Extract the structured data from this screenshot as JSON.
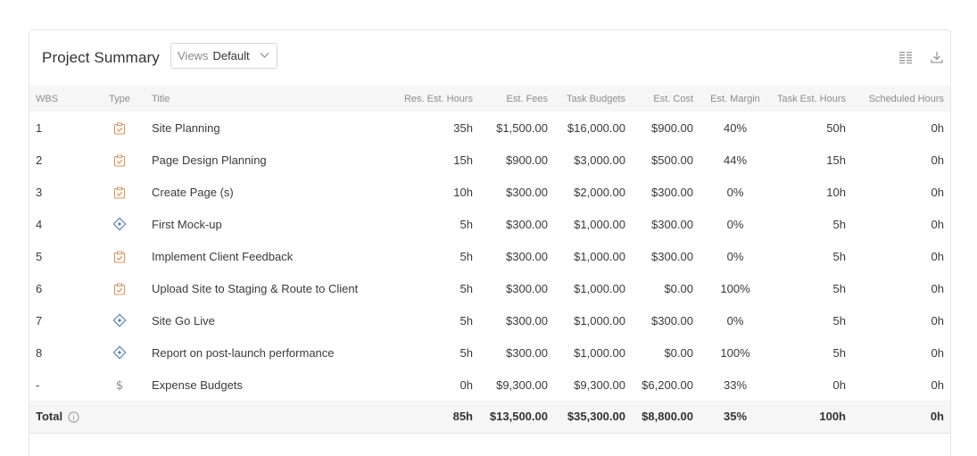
{
  "header": {
    "title": "Project Summary",
    "views_label": "Views",
    "views_value": "Default"
  },
  "columns": {
    "wbs": "WBS",
    "type": "Type",
    "title": "Title",
    "res_est_hours": "Res. Est. Hours",
    "est_fees": "Est. Fees",
    "task_budgets": "Task Budgets",
    "est_cost": "Est. Cost",
    "est_margin": "Est. Margin",
    "task_est_hours": "Task Est. Hours",
    "scheduled_hours": "Scheduled Hours"
  },
  "rows": [
    {
      "wbs": "1",
      "type": "task-icon",
      "title": "Site Planning",
      "res_est_hours": "35h",
      "est_fees": "$1,500.00",
      "task_budgets": "$16,000.00",
      "est_cost": "$900.00",
      "est_margin": "40%",
      "task_est_hours": "50h",
      "scheduled_hours": "0h"
    },
    {
      "wbs": "2",
      "type": "task-icon",
      "title": "Page Design Planning",
      "res_est_hours": "15h",
      "est_fees": "$900.00",
      "task_budgets": "$3,000.00",
      "est_cost": "$500.00",
      "est_margin": "44%",
      "task_est_hours": "15h",
      "scheduled_hours": "0h"
    },
    {
      "wbs": "3",
      "type": "task-icon",
      "title": "Create Page (s)",
      "res_est_hours": "10h",
      "est_fees": "$300.00",
      "task_budgets": "$2,000.00",
      "est_cost": "$300.00",
      "est_margin": "0%",
      "task_est_hours": "10h",
      "scheduled_hours": "0h"
    },
    {
      "wbs": "4",
      "type": "milestone-icon",
      "title": "First Mock-up",
      "res_est_hours": "5h",
      "est_fees": "$300.00",
      "task_budgets": "$1,000.00",
      "est_cost": "$300.00",
      "est_margin": "0%",
      "task_est_hours": "5h",
      "scheduled_hours": "0h"
    },
    {
      "wbs": "5",
      "type": "task-icon",
      "title": "Implement Client Feedback",
      "res_est_hours": "5h",
      "est_fees": "$300.00",
      "task_budgets": "$1,000.00",
      "est_cost": "$300.00",
      "est_margin": "0%",
      "task_est_hours": "5h",
      "scheduled_hours": "0h"
    },
    {
      "wbs": "6",
      "type": "task-icon",
      "title": "Upload Site to Staging & Route to Client",
      "res_est_hours": "5h",
      "est_fees": "$300.00",
      "task_budgets": "$1,000.00",
      "est_cost": "$0.00",
      "est_margin": "100%",
      "task_est_hours": "5h",
      "scheduled_hours": "0h"
    },
    {
      "wbs": "7",
      "type": "milestone-icon",
      "title": "Site Go Live",
      "res_est_hours": "5h",
      "est_fees": "$300.00",
      "task_budgets": "$1,000.00",
      "est_cost": "$300.00",
      "est_margin": "0%",
      "task_est_hours": "5h",
      "scheduled_hours": "0h"
    },
    {
      "wbs": "8",
      "type": "milestone-icon",
      "title": "Report on post-launch performance",
      "res_est_hours": "5h",
      "est_fees": "$300.00",
      "task_budgets": "$1,000.00",
      "est_cost": "$0.00",
      "est_margin": "100%",
      "task_est_hours": "5h",
      "scheduled_hours": "0h"
    },
    {
      "wbs": "-",
      "type": "expense-icon",
      "title": "Expense Budgets",
      "res_est_hours": "0h",
      "est_fees": "$9,300.00",
      "task_budgets": "$9,300.00",
      "est_cost": "$6,200.00",
      "est_margin": "33%",
      "task_est_hours": "0h",
      "scheduled_hours": "0h"
    }
  ],
  "total": {
    "label": "Total",
    "res_est_hours": "85h",
    "est_fees": "$13,500.00",
    "task_budgets": "$35,300.00",
    "est_cost": "$8,800.00",
    "est_margin": "35%",
    "task_est_hours": "100h",
    "scheduled_hours": "0h"
  },
  "colors": {
    "task_icon": "#d9945c",
    "milestone_icon": "#4a7fc1",
    "expense_icon": "#8a8a8a",
    "header_bg": "#f6f6f6"
  }
}
